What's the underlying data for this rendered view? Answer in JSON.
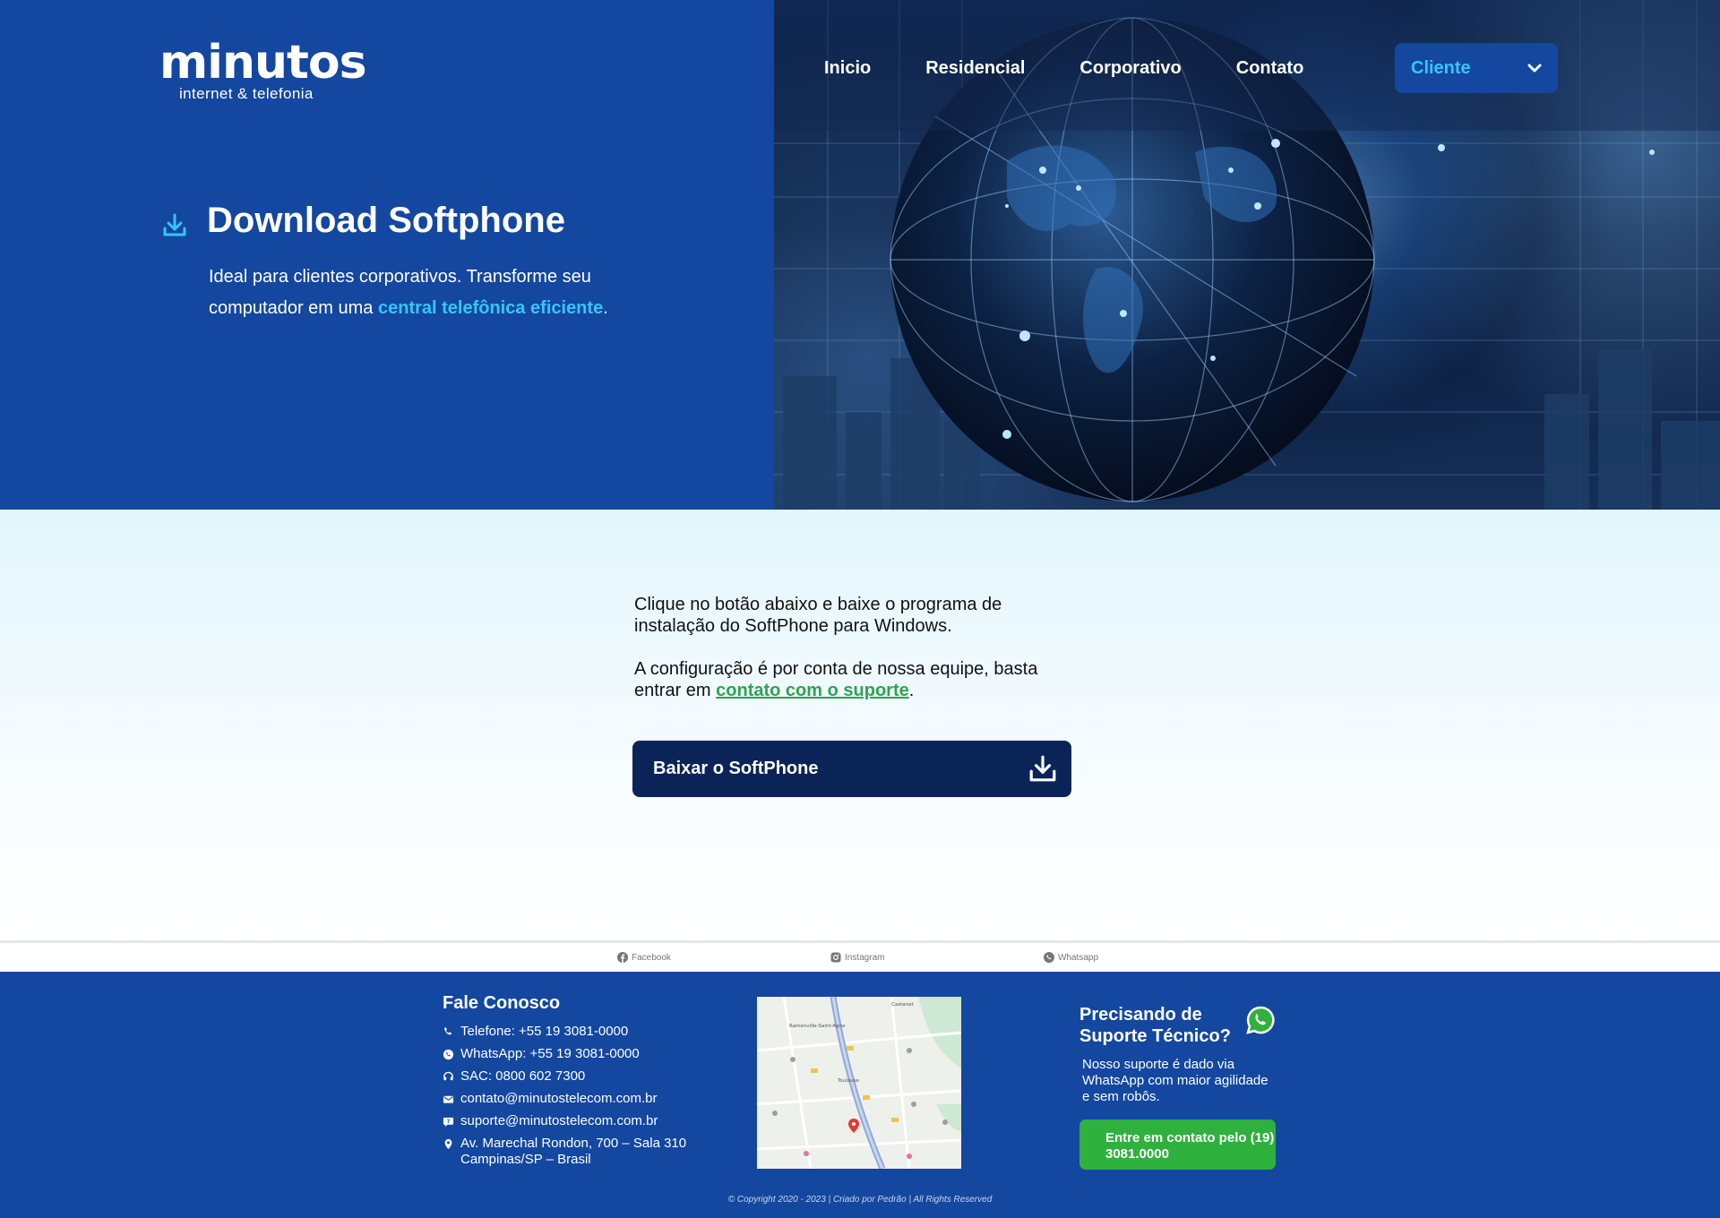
{
  "brand": {
    "name": "minutos",
    "tagline": "internet & telefonia"
  },
  "nav": {
    "items": [
      "Inicio",
      "Residencial",
      "Corporativo",
      "Contato"
    ],
    "client_menu": "Cliente"
  },
  "hero": {
    "title": "Download Softphone",
    "desc_part1": "Ideal para clientes corporativos. Transforme seu computador em uma ",
    "desc_highlight": "central telefônica eficiente",
    "desc_part2": "."
  },
  "main": {
    "para1": "Clique no botão abaixo e baixe o programa de instalação do SoftPhone para Windows.",
    "para2_part1": "A configuração é por conta de nossa equipe, basta entrar em ",
    "para2_link": "contato com o suporte",
    "para2_part2": ".",
    "download_button": "Baixar o SoftPhone"
  },
  "social": {
    "facebook": "Facebook",
    "instagram": "Instagram",
    "whatsapp": "Whatsapp"
  },
  "footer": {
    "contact_title": "Fale Conosco",
    "phone": "Telefone: +55 19 3081-0000",
    "whatsapp": "WhatsApp: +55 19 3081-0000",
    "sac": "SAC: 0800 602 7300",
    "email_contact": "contato@minutostelecom.com.br",
    "email_support": "suporte@minutostelecom.com.br",
    "address_line1": "Av. Marechal Rondon, 700 – Sala 310",
    "address_line2": "Campinas/SP – Brasil",
    "map_labels": [
      "Ramenville-Saint-Agne",
      "Toulouse",
      "Castanet"
    ],
    "support_title": "Precisando de Suporte Técnico?",
    "support_desc": "Nosso suporte é dado via WhatsApp com maior agilidade e sem robôs.",
    "support_button": "Entre em contato pelo (19) 3081.0000",
    "copyright": "© Copyright 2020 - 2023 | Criado por Pedrão | All Rights Reserved"
  },
  "colors": {
    "brand_blue": "#1347a0",
    "accent_cyan": "#36c6f4",
    "dark_navy": "#0b2458",
    "whatsapp_green": "#2eb13d",
    "link_green": "#2da44e"
  }
}
